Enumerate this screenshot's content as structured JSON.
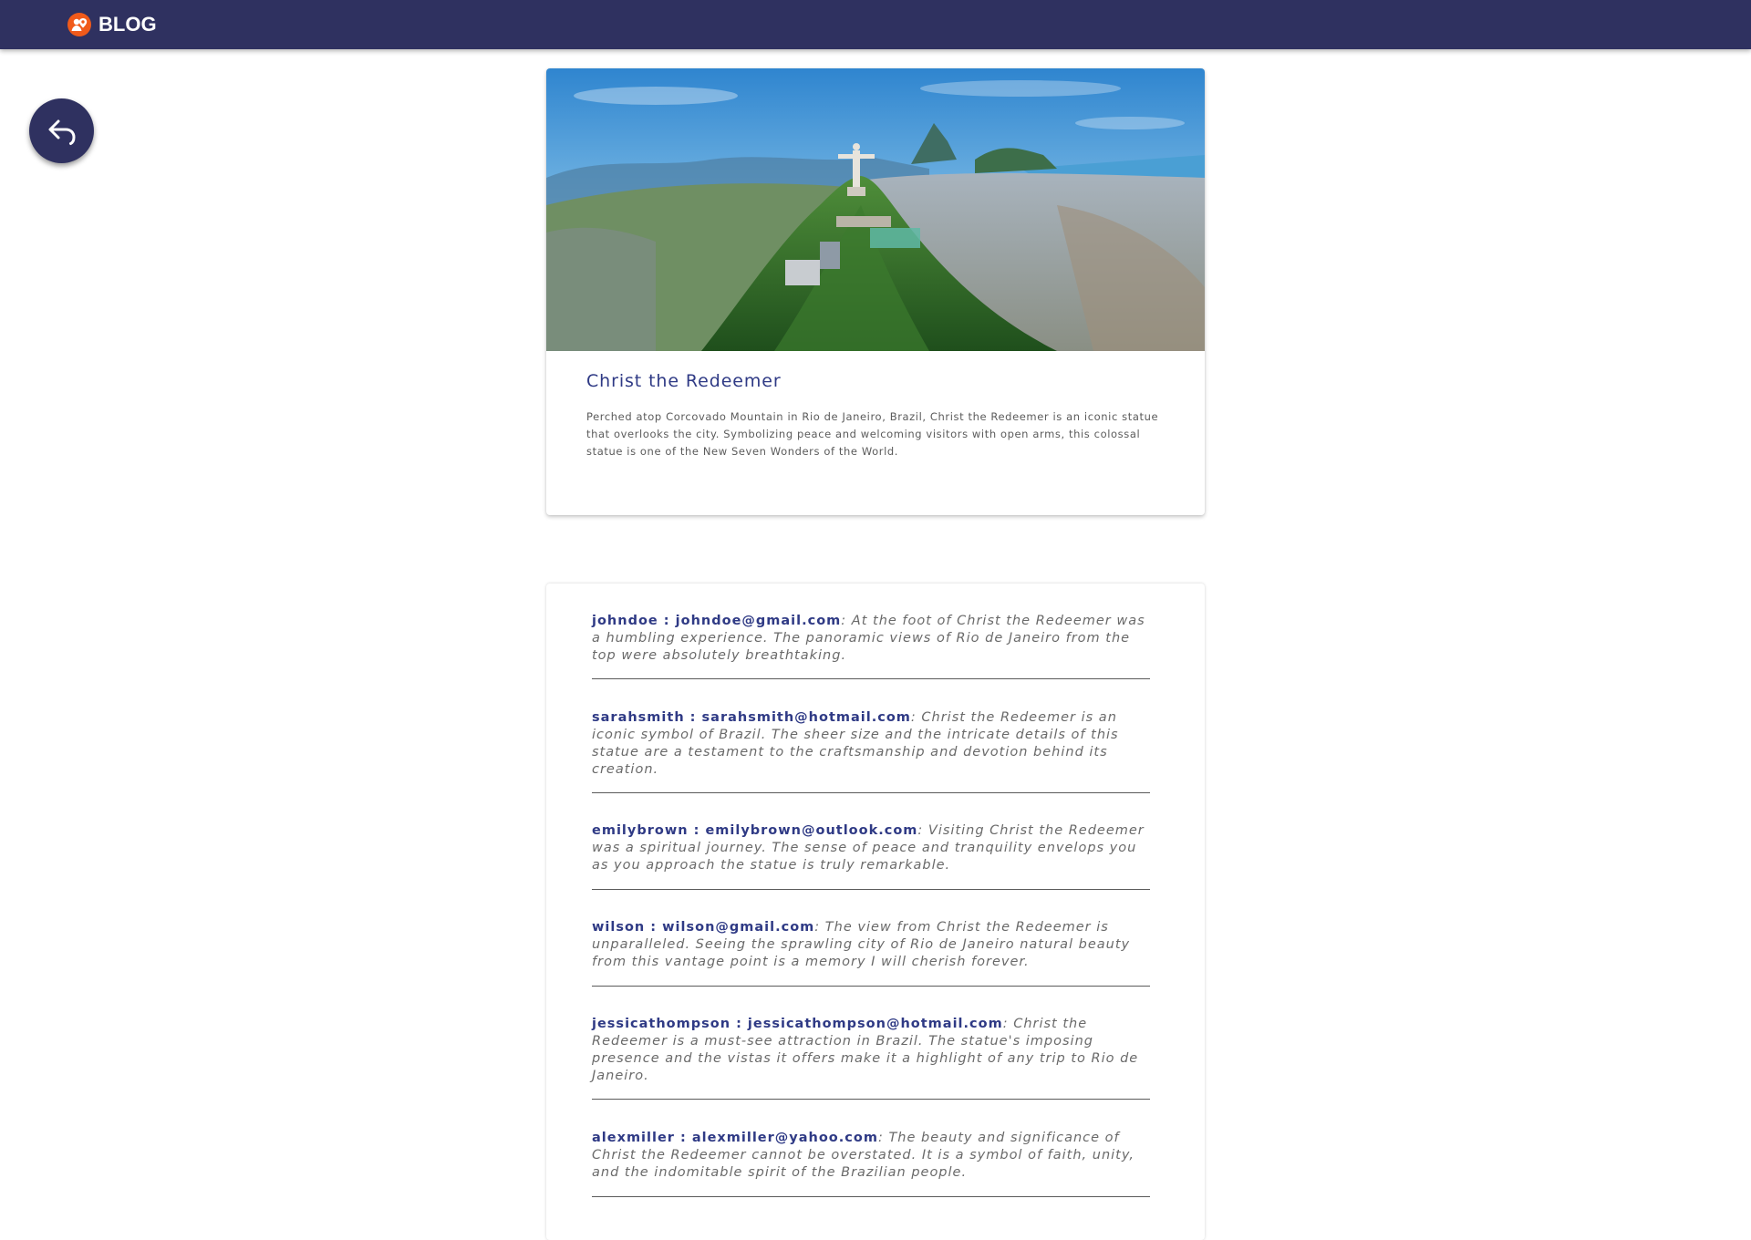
{
  "header": {
    "brand": "BLOG",
    "logo_icon": "blog-logo-icon",
    "background": "#2f3160",
    "logo_color": "#f05a1a"
  },
  "back_button": {
    "icon": "undo-arrow-icon"
  },
  "post": {
    "image_icon": "christ-the-redeemer-photo",
    "title": "Christ the Redeemer",
    "description": "Perched atop Corcovado Mountain in Rio de Janeiro, Brazil, Christ the Redeemer is an iconic statue that overlooks the city. Symbolizing peace and welcoming visitors with open arms, this colossal statue is one of the New Seven Wonders of the World."
  },
  "comments": [
    {
      "user": "johndoe : johndoe@gmail.com",
      "text": ": At the foot of Christ the Redeemer was a humbling experience. The panoramic views of Rio de Janeiro from the top were absolutely breathtaking."
    },
    {
      "user": "sarahsmith : sarahsmith@hotmail.com",
      "text": ": Christ the Redeemer is an iconic symbol of Brazil. The sheer size and the intricate details of this statue are a testament to the craftsmanship and devotion behind its creation."
    },
    {
      "user": "emilybrown : emilybrown@outlook.com",
      "text": ": Visiting Christ the Redeemer was a spiritual journey. The sense of peace and tranquility envelops you as you approach the statue is truly remarkable."
    },
    {
      "user": "wilson : wilson@gmail.com",
      "text": ": The view from Christ the Redeemer is unparalleled. Seeing the sprawling city of Rio de Janeiro natural beauty from this vantage point is a memory I will cherish forever."
    },
    {
      "user": "jessicathompson : jessicathompson@hotmail.com",
      "text": ": Christ the Redeemer is a must-see attraction in Brazil. The statue's imposing presence and the vistas it offers make it a highlight of any trip to Rio de Janeiro."
    },
    {
      "user": "alexmiller : alexmiller@yahoo.com",
      "text": ": The beauty and significance of Christ the Redeemer cannot be overstated. It is a symbol of faith, unity, and the indomitable spirit of the Brazilian people."
    }
  ]
}
